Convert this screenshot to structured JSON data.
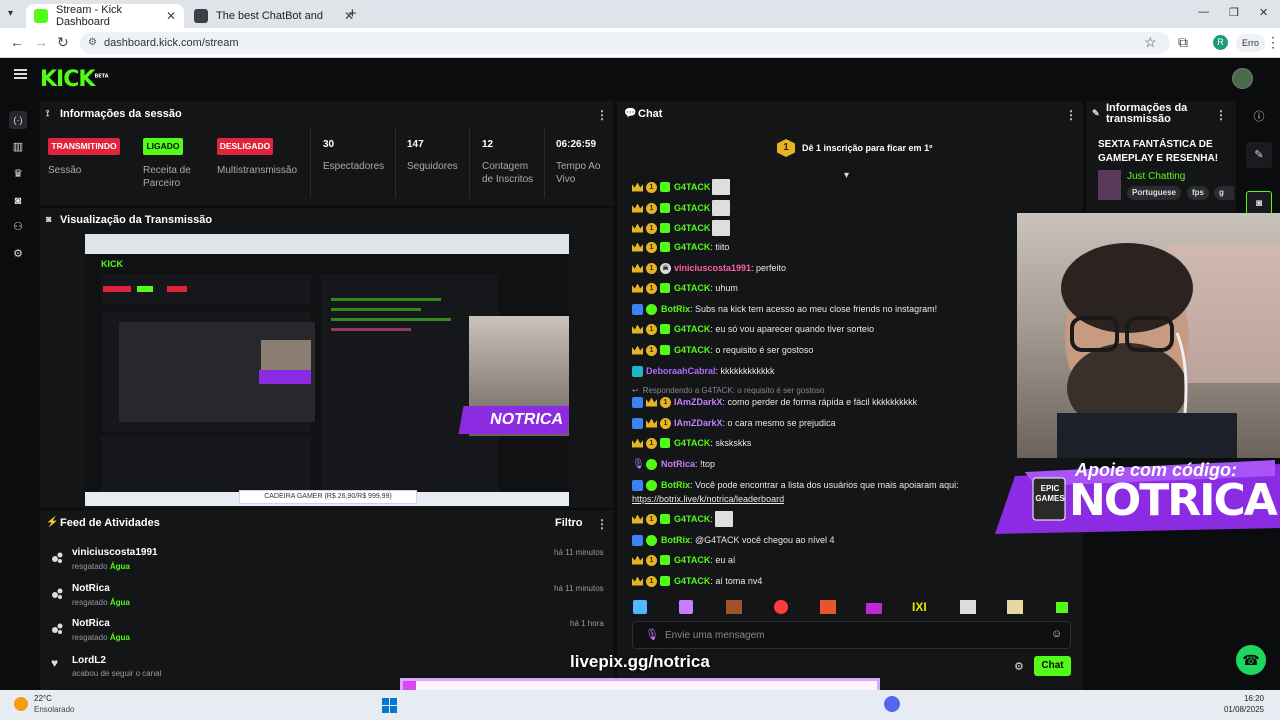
{
  "browser": {
    "tabs": [
      {
        "title": "Stream - Kick Dashboard"
      },
      {
        "title": "The best ChatBot and Widgets"
      }
    ],
    "url": "dashboard.kick.com/stream",
    "profile_initial": "R",
    "error_label": "Erro"
  },
  "kick": {
    "logo": "KICK",
    "logo_sup": "BETA"
  },
  "session": {
    "title": "Informações da sessão",
    "statuses": [
      {
        "badge": "TRANSMITINDO",
        "label": "Sessão",
        "color": "#e0243b"
      },
      {
        "badge": "LIGADO",
        "label": "Receita de Parceiro",
        "color": "#53fc18"
      },
      {
        "badge": "DESLIGADO",
        "label": "Multistransmissão",
        "color": "#e0243b"
      }
    ],
    "stats": [
      {
        "value": "30",
        "label": "Espectadores"
      },
      {
        "value": "147",
        "label": "Seguidores"
      },
      {
        "value": "12",
        "label": "Contagem de Inscritos"
      },
      {
        "value": "06:26:59",
        "label": "Tempo Ao Vivo"
      }
    ]
  },
  "preview": {
    "title": "Visualização da Transmissão"
  },
  "feed": {
    "title": "Feed de Atividades",
    "filter_label": "Filtro",
    "items": [
      {
        "name": "viniciuscosta1991",
        "action": "resgatado",
        "reward": "Água",
        "time": "há 11 minutos"
      },
      {
        "name": "NotRica",
        "action": "resgatado",
        "reward": "Água",
        "time": "há 11 minutos"
      },
      {
        "name": "NotRica",
        "action": "resgatado",
        "reward": "Água",
        "time": "há 1 hora"
      },
      {
        "name": "LordL2",
        "action": "acabou de seguir o canal",
        "reward": "",
        "time": ""
      }
    ]
  },
  "chat": {
    "title": "Chat",
    "pinned": "Dê 1 inscrição para ficar em 1º",
    "pinned_rank": "1",
    "messages": [
      {
        "user": "G4TACK",
        "text": "",
        "emote": true
      },
      {
        "user": "G4TACK",
        "text": "",
        "emote": true
      },
      {
        "user": "G4TACK",
        "text": "",
        "emote": true
      },
      {
        "user": "G4TACK",
        "text": ": tiito"
      },
      {
        "user": "viniciuscosta1991",
        "text": ": perfeito"
      },
      {
        "user": "G4TACK",
        "text": ": uhum"
      },
      {
        "user": "BotRix",
        "text": ": Subs na kick tem acesso ao meu close friends no instagram!"
      },
      {
        "user": "G4TACK",
        "text": ": eu só vou aparecer quando tiver sorteio"
      },
      {
        "user": "G4TACK",
        "text": ": o requisito é ser gostoso"
      },
      {
        "user": "DeboraahCabral",
        "text": ": kkkkkkkkkkkk"
      },
      {
        "reply": "Respondendo a G4TACK: o requisito é ser gostoso"
      },
      {
        "user": "IAmZDarkX",
        "text": ": como perder de forma rápida e fácil kkkkkkkkkk"
      },
      {
        "user": "IAmZDarkX",
        "text": ": o cara mesmo se prejudica"
      },
      {
        "user": "G4TACK",
        "text": ": skskskks"
      },
      {
        "user": "NotRica",
        "text": ": !top"
      },
      {
        "user": "BotRix",
        "text": ": Você pode encontrar a lista dos usuários que mais apoiaram aqui:"
      },
      {
        "link": "https://botrix.live/k/notrica/leaderboard"
      },
      {
        "user": "G4TACK",
        "text": ":",
        "emote": true
      },
      {
        "user": "BotRix",
        "text": ": @G4TACK você chegou ao nível 4"
      },
      {
        "user": "G4TACK",
        "text": ": eu aí"
      },
      {
        "user": "G4TACK",
        "text": ": aí toma nv4"
      }
    ],
    "input_placeholder": "Envie uma mensagem",
    "send_label": "Chat"
  },
  "stream_info": {
    "title": "Informações da transmissão",
    "stream_title": "SEXTA FANTÁSTICA DE GAMEPLAY E RESENHA!",
    "category": "Just Chatting",
    "tags": [
      "Portuguese",
      "fps",
      "g"
    ]
  },
  "overlay": {
    "epic_line1": "Apoie com código:",
    "epic_line2": "NOTRICA",
    "epic_logo": "EPIC GAMES",
    "livepix": "livepix.gg/notrica",
    "goal": "CADEIRA GAMER (R$ 26,90/R$ 999,99)",
    "goal_progress": 0.027
  },
  "taskbar": {
    "weather_temp": "22°C",
    "weather_desc": "Ensolarado",
    "time": "16:20",
    "date": "01/08/2025"
  },
  "colors": {
    "kick_green": "#53fc18",
    "live_red": "#e0243b",
    "panel": "#141517"
  }
}
